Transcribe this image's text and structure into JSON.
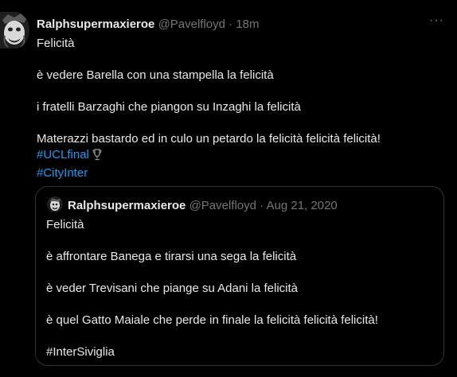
{
  "tweet": {
    "display_name": "Ralphsupermaxieroe",
    "handle": "@Pavelfloyd",
    "separator": "·",
    "time": "18m",
    "more_label": "···",
    "lines": [
      "Felicità",
      "è vedere Barella con una stampella la felicità",
      "i fratelli Barzaghi che piangon su Inzaghi la felicità",
      "Materazzi bastardo ed in culo un petardo la felicità felicità felicità!"
    ],
    "hashtags": [
      "#UCLfinal",
      "#CityInter"
    ],
    "trophy_icon": "trophy-icon"
  },
  "quoted": {
    "display_name": "Ralphsupermaxieroe",
    "handle": "@Pavelfloyd",
    "separator": "·",
    "date": "Aug 21, 2020",
    "lines": [
      "Felicità",
      "è affrontare Banega e tirarsi una sega la felicità",
      "è veder Trevisani che piange su Adani la felicità",
      "è quel Gatto Maiale che perde in finale la felicità felicità felicità!",
      "#InterSiviglia"
    ]
  },
  "colors": {
    "background": "#000000",
    "text": "#e7e9ea",
    "muted": "#71767b",
    "link": "#1d9bf0",
    "border": "#2f3336"
  }
}
